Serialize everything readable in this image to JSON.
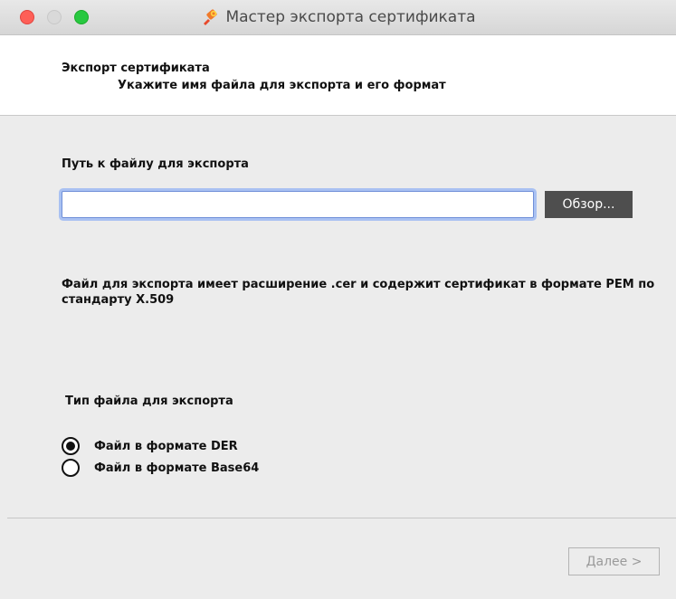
{
  "window": {
    "title": "Мастер экспорта сертификата",
    "icon": "certificate-ribbon-icon"
  },
  "header": {
    "title": "Экспорт сертификата",
    "subtitle": "Укажите имя файла для экспорта и его формат"
  },
  "export_path": {
    "label": "Путь к файлу для экспорта",
    "value": "",
    "browse_label": "Обзор..."
  },
  "info": {
    "text": "Файл для экспорта имеет расширение .cer и содержит сертификат в формате PEM по стандарту X.509"
  },
  "file_type": {
    "label": "Тип файла для экспорта",
    "options": [
      {
        "label": "Файл в формате DER",
        "selected": true
      },
      {
        "label": "Файл в формате Base64",
        "selected": false
      }
    ]
  },
  "footer": {
    "next_label": "Далее >"
  },
  "colors": {
    "close": "#fe5f57",
    "minimize": "#d9d9d9",
    "maximize": "#28c840",
    "focus_ring": "#a9c1f2",
    "browse_bg": "#4e4e4e"
  }
}
